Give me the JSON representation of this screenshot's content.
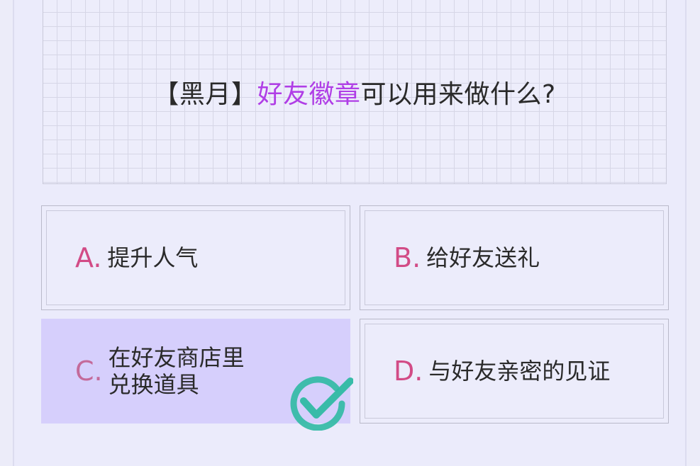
{
  "question": {
    "prefix": "【黑月】",
    "highlight": "好友徽章",
    "suffix": "可以用来做什么?",
    "highlight_color": "#b03ee6"
  },
  "options": [
    {
      "letter": "A.",
      "text": "提升人气",
      "selected": false
    },
    {
      "letter": "B.",
      "text": "给好友送礼",
      "selected": false
    },
    {
      "letter": "C.",
      "text": "在好友商店里\n兑换道具",
      "selected": true
    },
    {
      "letter": "D.",
      "text": "与好友亲密的见证",
      "selected": false
    }
  ],
  "colors": {
    "letter": "#d24b86",
    "selected_background": "#d6cffc",
    "check": "#2fb9a3"
  },
  "icons": {
    "correct_mark": "check-circle-icon"
  }
}
